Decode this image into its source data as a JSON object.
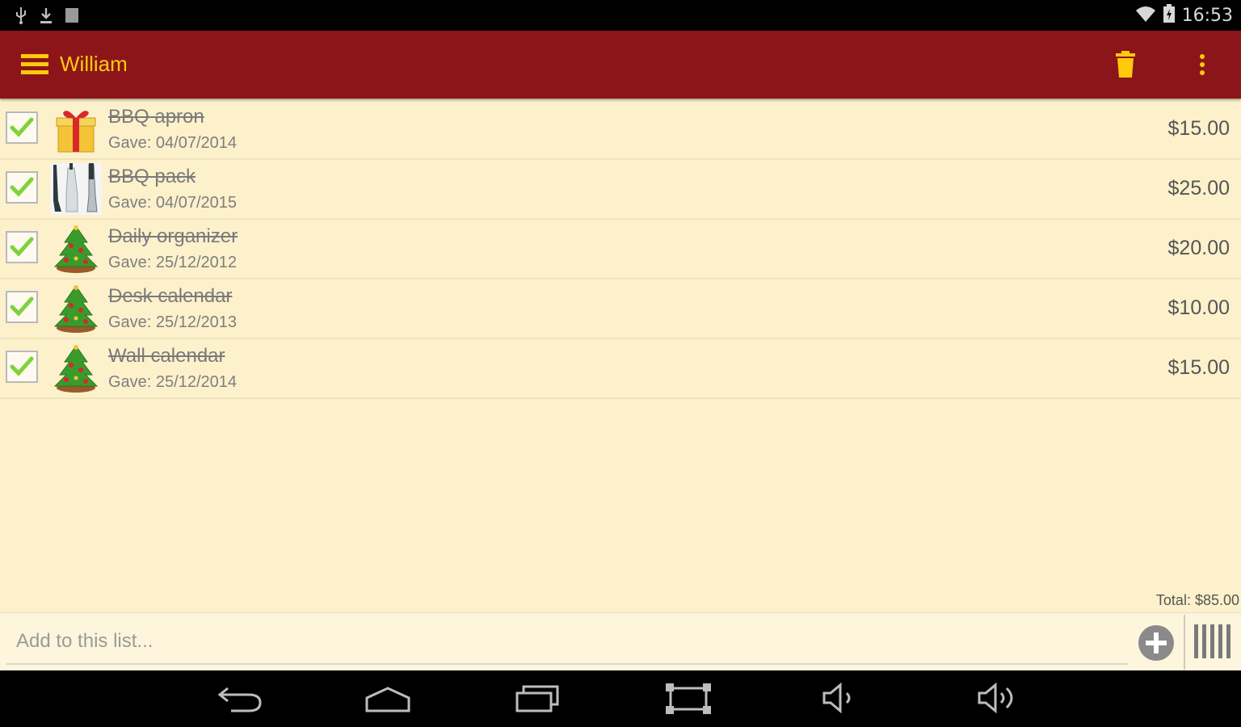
{
  "status_bar": {
    "time": "16:53",
    "icons": [
      "usb-icon",
      "download-icon",
      "notification-icon",
      "wifi-icon",
      "battery-icon"
    ]
  },
  "app_bar": {
    "title": "William",
    "accent": "#ffc90e",
    "background": "#8b1519",
    "icons": [
      "menu-icon",
      "trash-icon",
      "more-vert-icon"
    ]
  },
  "items": [
    {
      "name": "BBQ apron",
      "gave": "Gave: 04/07/2014",
      "price": "$15.00",
      "checked": true,
      "thumb": "gift-icon"
    },
    {
      "name": "BBQ pack",
      "gave": "Gave: 04/07/2015",
      "price": "$25.00",
      "checked": true,
      "thumb": "bbq-tools-photo"
    },
    {
      "name": "Daily organizer",
      "gave": "Gave: 25/12/2012",
      "price": "$20.00",
      "checked": true,
      "thumb": "christmas-tree-icon"
    },
    {
      "name": "Desk calendar",
      "gave": "Gave: 25/12/2013",
      "price": "$10.00",
      "checked": true,
      "thumb": "christmas-tree-icon"
    },
    {
      "name": "Wall calendar",
      "gave": "Gave: 25/12/2014",
      "price": "$15.00",
      "checked": true,
      "thumb": "christmas-tree-icon"
    }
  ],
  "total": "Total: $85.00",
  "add_bar": {
    "placeholder": "Add to this list...",
    "icons": [
      "add-circle-icon",
      "barcode-icon"
    ]
  },
  "nav_bar": {
    "icons": [
      "back-icon",
      "home-icon",
      "recents-icon",
      "screenshot-icon",
      "volume-down-icon",
      "volume-up-icon"
    ]
  }
}
